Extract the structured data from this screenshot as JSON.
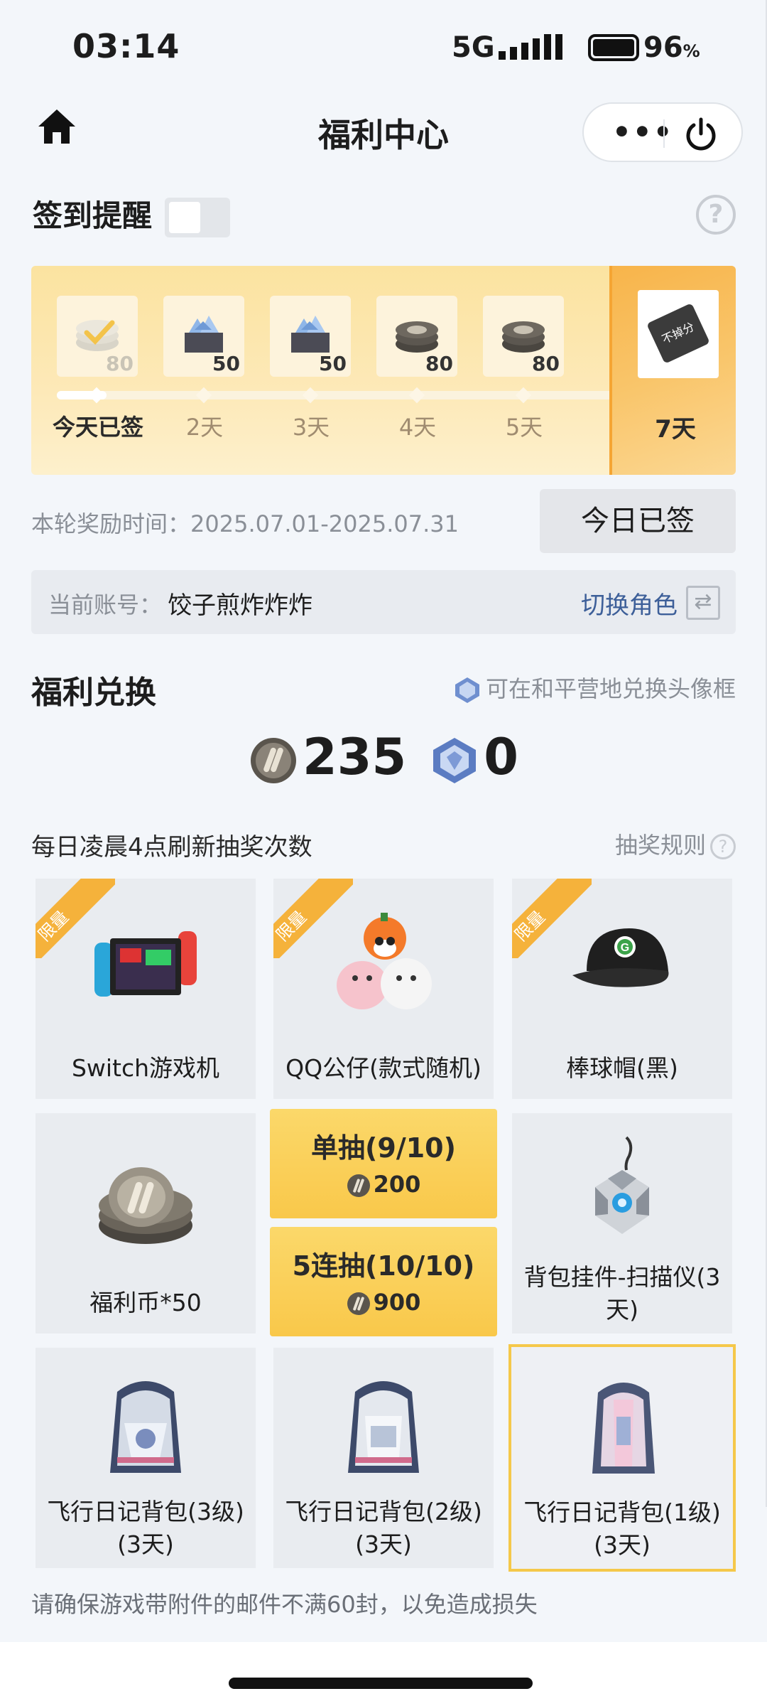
{
  "status_bar": {
    "time": "03:14",
    "network": "5G",
    "battery": "96",
    "battery_unit": "%"
  },
  "nav": {
    "title": "福利中心",
    "more_label": "•••"
  },
  "signin": {
    "reminder_label": "签到提醒",
    "help_icon": "?",
    "days": [
      {
        "label": "今天已签",
        "reward": "80",
        "icon": "coin-stack-icon",
        "signed": true
      },
      {
        "label": "2天",
        "reward": "50",
        "icon": "diamond-chest-icon",
        "signed": false
      },
      {
        "label": "3天",
        "reward": "50",
        "icon": "diamond-chest-icon",
        "signed": false
      },
      {
        "label": "4天",
        "reward": "80",
        "icon": "coin-stack-icon",
        "signed": false
      },
      {
        "label": "5天",
        "reward": "80",
        "icon": "coin-stack-icon",
        "signed": false
      }
    ],
    "day7": {
      "label": "7天",
      "ticket_text": "不掉分"
    },
    "period": "本轮奖励时间：2025.07.01-2025.07.31",
    "signed_button": "今日已签"
  },
  "account": {
    "label": "当前账号：",
    "name": "饺子煎炸炸炸",
    "switch_label": "切换角色"
  },
  "exchange": {
    "title": "福利兑换",
    "note": "可在和平营地兑换头像框",
    "coin_balance": "235",
    "gem_balance": "0",
    "refresh_note": "每日凌晨4点刷新抽奖次数",
    "rules_label": "抽奖规则"
  },
  "prizes": [
    {
      "label": "Switch游戏机",
      "limited": "限量",
      "icon": "game-console-icon"
    },
    {
      "label": "QQ公仔(款式随机)",
      "limited": "限量",
      "icon": "plush-toys-icon"
    },
    {
      "label": "棒球帽(黑)",
      "limited": "限量",
      "icon": "baseball-cap-icon"
    },
    {
      "label": "福利币*50",
      "icon": "coin-stack-icon"
    },
    {
      "label": "背包挂件-扫描仪(3天)",
      "icon": "scanner-charm-icon"
    },
    {
      "label": "飞行日记背包(3级)(3天)",
      "icon": "backpack-icon"
    },
    {
      "label": "飞行日记背包(2级)(3天)",
      "icon": "backpack-icon"
    },
    {
      "label": "飞行日记背包(1级)(3天)",
      "icon": "backpack-icon"
    }
  ],
  "draw": {
    "single_label": "单抽(9/10)",
    "single_cost": "200",
    "multi_label": "5连抽(10/10)",
    "multi_cost": "900"
  },
  "warning": "请确保游戏带附件的邮件不满60封，以免造成损失",
  "colors": {
    "gold": "#f9c84a",
    "accent_blue": "#3d5f99",
    "ribbon": "#f5b23b"
  }
}
